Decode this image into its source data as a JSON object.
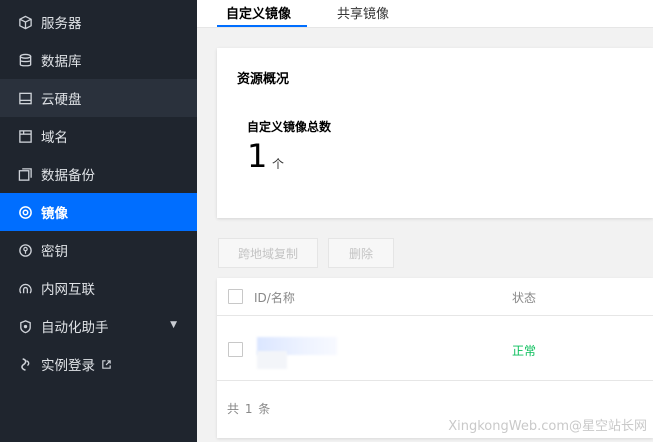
{
  "sidebar": {
    "items": [
      {
        "label": "服务器",
        "icon": "box-icon"
      },
      {
        "label": "数据库",
        "icon": "database-icon"
      },
      {
        "label": "云硬盘",
        "icon": "disk-icon"
      },
      {
        "label": "域名",
        "icon": "domain-icon"
      },
      {
        "label": "数据备份",
        "icon": "backup-icon"
      },
      {
        "label": "镜像",
        "icon": "image-icon"
      },
      {
        "label": "密钥",
        "icon": "key-icon"
      },
      {
        "label": "内网互联",
        "icon": "network-icon"
      },
      {
        "label": "自动化助手",
        "icon": "assistant-icon"
      },
      {
        "label": "实例登录",
        "icon": "login-icon"
      }
    ],
    "active_index": 5
  },
  "tabs": [
    {
      "label": "自定义镜像"
    },
    {
      "label": "共享镜像"
    }
  ],
  "overview": {
    "title": "资源概况",
    "stat_label": "自定义镜像总数",
    "stat_value": "1",
    "stat_unit": "个"
  },
  "actions": {
    "copy_cross_region": "跨地域复制",
    "delete": "删除"
  },
  "table": {
    "columns": [
      "ID/名称",
      "状态"
    ],
    "rows": [
      {
        "status": "正常"
      }
    ],
    "total": "共 1 条"
  },
  "watermark": "XingkongWeb.com@星空站长网",
  "colors": {
    "sidebar_bg": "#1f252e",
    "active": "#006eff",
    "status_ok": "#0abf5b"
  }
}
